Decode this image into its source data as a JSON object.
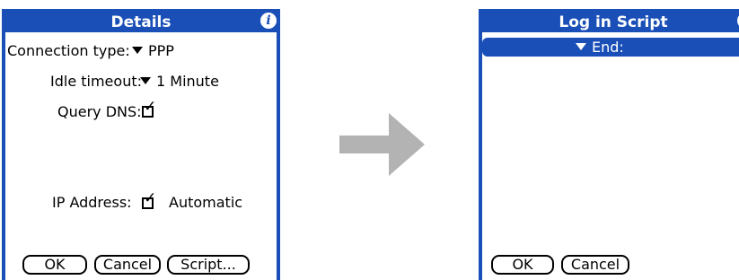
{
  "details": {
    "title": "Details",
    "connection_type": {
      "label": "Connection type:",
      "value": "PPP"
    },
    "idle_timeout": {
      "label": "Idle timeout:",
      "value": "1 Minute"
    },
    "query_dns": {
      "label": "Query DNS:",
      "checked": true
    },
    "ip_address": {
      "label": "IP Address:",
      "checked": true,
      "value": "Automatic"
    },
    "buttons": {
      "ok": "OK",
      "cancel": "Cancel",
      "script": "Script..."
    }
  },
  "login_script": {
    "title": "Log in Script",
    "selected_command": "End:",
    "buttons": {
      "ok": "OK",
      "cancel": "Cancel"
    }
  },
  "icons": {
    "info": "i",
    "checkmark": "✓"
  },
  "colors": {
    "title_bar": "#1a4fb7",
    "arrow": "#b3b3b3"
  }
}
